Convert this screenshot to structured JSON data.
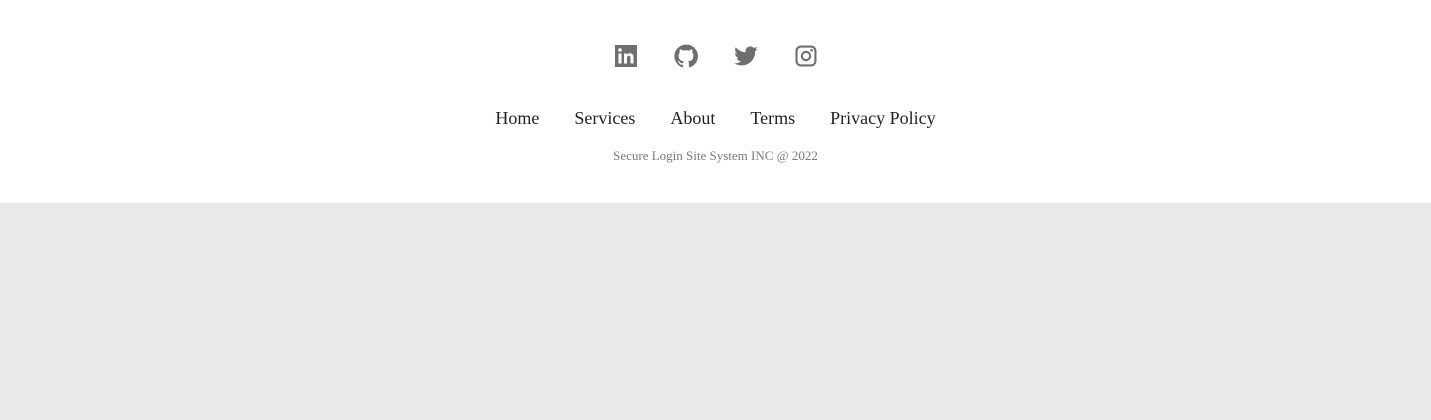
{
  "footer": {
    "social": [
      {
        "icon": "linkedin-icon",
        "label": "LinkedIn"
      },
      {
        "icon": "github-icon",
        "label": "GitHub"
      },
      {
        "icon": "twitter-icon",
        "label": "Twitter"
      },
      {
        "icon": "instagram-icon",
        "label": "Instagram"
      }
    ],
    "nav": {
      "home": "Home",
      "services": "Services",
      "about": "About",
      "terms": "Terms",
      "privacy": "Privacy Policy"
    },
    "copyright": "Secure Login Site System INC @ 2022"
  },
  "colors": {
    "footer_background": "#ffffff",
    "page_background": "#e9e9e9",
    "icon": "#6f6f6f",
    "link_text": "#222222",
    "muted_text": "#7a7a7a"
  }
}
